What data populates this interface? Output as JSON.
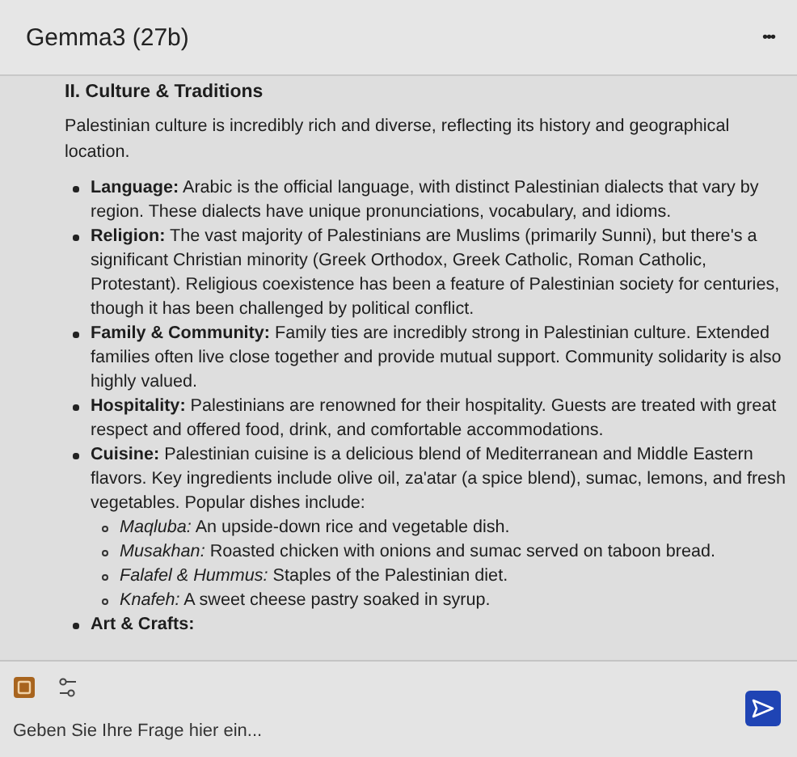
{
  "header": {
    "title": "Gemma3 (27b)",
    "menu": "•••"
  },
  "message": {
    "heading": "II. Culture & Traditions",
    "intro": "Palestinian culture is incredibly rich and diverse, reflecting its history and geographical location.",
    "items": [
      {
        "text": "**Language:** Arabic is the official language, with distinct Palestinian dialects that vary by region. These dialects have unique pronunciations, vocabulary, and idioms."
      },
      {
        "text": "**Religion:** The vast majority of Palestinians are Muslims (primarily Sunni), but there's a significant Christian minority (Greek Orthodox, Greek Catholic, Roman Catholic, Protestant). Religious coexistence has been a feature of Palestinian society for centuries, though it has been challenged by political conflict."
      },
      {
        "text": "**Family & Community:** Family ties are incredibly strong in Palestinian culture. Extended families often live close together and provide mutual support. Community solidarity is also highly valued."
      },
      {
        "text": "**Hospitality:** Palestinians are renowned for their hospitality. Guests are treated with great respect and offered food, drink, and comfortable accommodations."
      },
      {
        "text": "**Cuisine:** Palestinian cuisine is a delicious blend of Mediterranean and Middle Eastern flavors. Key ingredients include olive oil, za'atar (a spice blend), sumac, lemons, and fresh vegetables. Popular dishes include:",
        "children": [
          {
            "text": "*Maqluba:* An upside-down rice and vegetable dish."
          },
          {
            "text": "*Musakhan:* Roasted chicken with onions and sumac served on taboon bread."
          },
          {
            "text": "*Falafel & Hummus:* Staples of the Palestinian diet."
          },
          {
            "text": "*Knafeh:* A sweet cheese pastry soaked in syrup."
          }
        ]
      },
      {
        "text": "**Art & Crafts:**"
      }
    ]
  },
  "composer": {
    "placeholder": "Geben Sie Ihre Frage hier ein..."
  }
}
